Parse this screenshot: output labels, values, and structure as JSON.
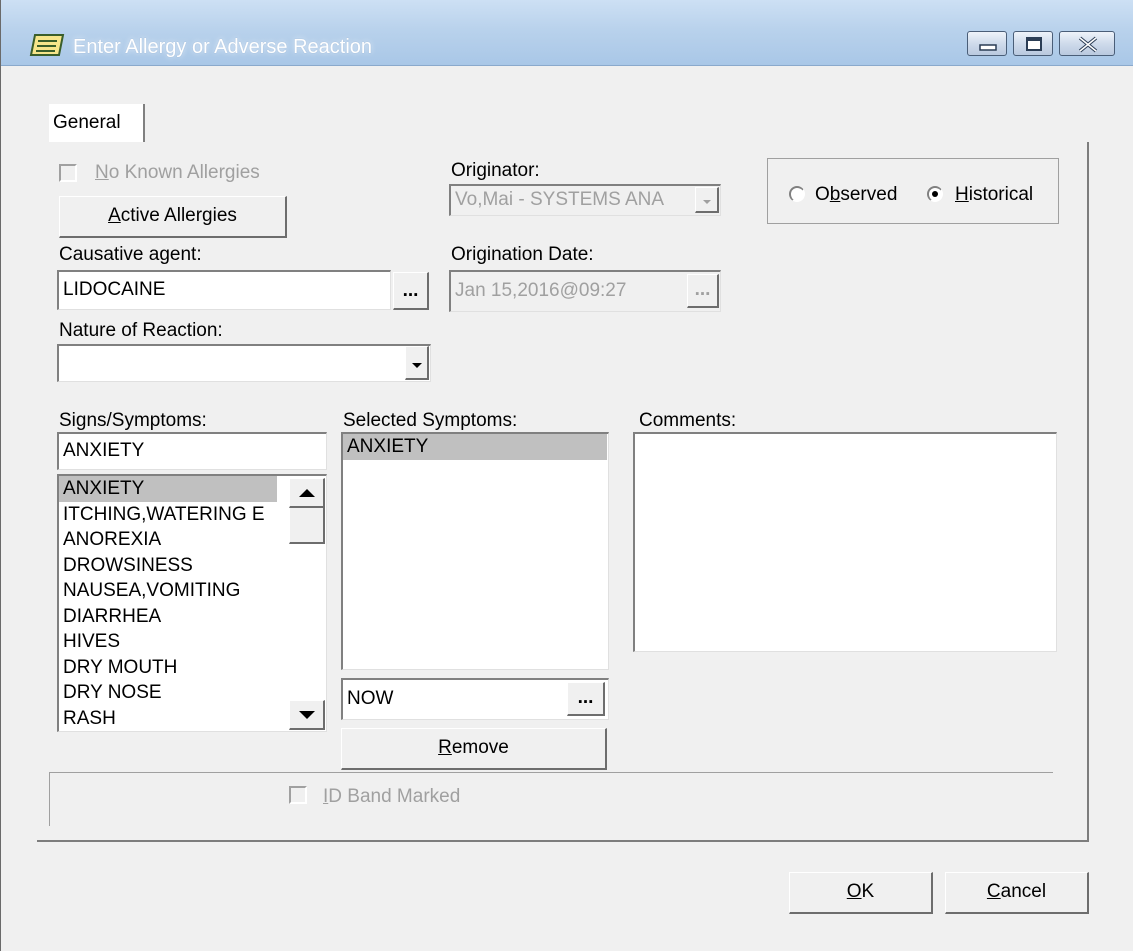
{
  "window": {
    "title": "Enter Allergy or Adverse Reaction",
    "icon": "allergy-form-icon",
    "controls": [
      "minimize-icon",
      "maximize-icon",
      "close-icon"
    ]
  },
  "tabs": [
    {
      "label": "General",
      "active": true
    }
  ],
  "no_known_allergies": {
    "label_first": "N",
    "label_rest": "o Known Allergies",
    "checked": false,
    "enabled": false
  },
  "active_allergies_button": {
    "label_first": "A",
    "label_rest": "ctive Allergies"
  },
  "originator": {
    "label": "Originator:",
    "value": "Vo,Mai - SYSTEMS ANA"
  },
  "observation": {
    "observed_label_pre": "O",
    "observed_label_accel": "b",
    "observed_label_post": "served",
    "historical_label_first": "H",
    "historical_label_rest": "istorical",
    "selected": "Historical"
  },
  "causative_agent": {
    "label": "Causative agent:",
    "value": "LIDOCAINE",
    "button": "..."
  },
  "origination_date": {
    "label": "Origination Date:",
    "value": "Jan 15,2016@09:27",
    "button": "..."
  },
  "nature_of_reaction": {
    "label": "Nature of Reaction:",
    "value": ""
  },
  "signs_symptoms": {
    "label": "Signs/Symptoms:",
    "search_value": "ANXIETY",
    "items": [
      "ANXIETY",
      "ITCHING,WATERING E",
      "ANOREXIA",
      "DROWSINESS",
      "NAUSEA,VOMITING",
      "DIARRHEA",
      "HIVES",
      "DRY MOUTH",
      "DRY NOSE",
      "RASH"
    ],
    "selected_index": 0
  },
  "selected_symptoms": {
    "label": "Selected Symptoms:",
    "items": [
      "ANXIETY"
    ],
    "date_value": "NOW",
    "date_button": "...",
    "remove_label_first": "R",
    "remove_label_rest": "emove"
  },
  "comments": {
    "label": "Comments:",
    "value": ""
  },
  "id_band": {
    "label_first": "I",
    "label_rest": "D Band Marked",
    "checked": false,
    "enabled": false
  },
  "footer": {
    "ok_first": "O",
    "ok_rest": "K",
    "cancel_first": "C",
    "cancel_rest": "ancel"
  }
}
